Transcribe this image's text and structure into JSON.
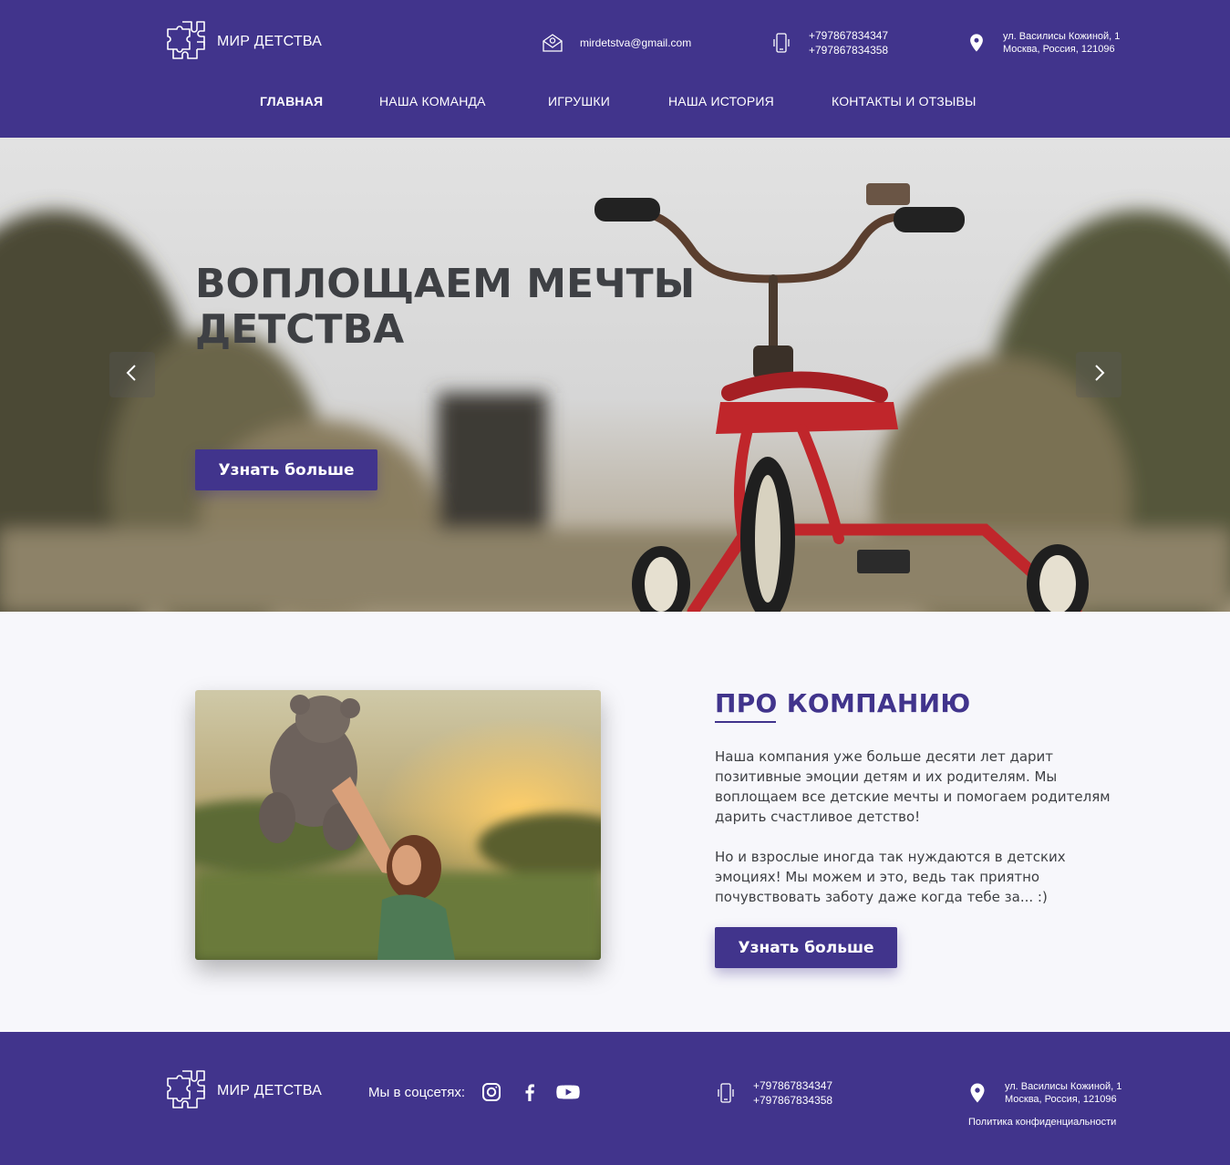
{
  "brand": {
    "name": "МИР ДЕТСТВА",
    "logo_icon": "puzzle-icon"
  },
  "header": {
    "email": {
      "icon": "email-icon",
      "value": "mirdetstva@gmail.com"
    },
    "phones": {
      "icon": "phone-icon",
      "line1": "+797867834347",
      "line2": "+797867834358"
    },
    "address": {
      "icon": "map-pin-icon",
      "line1": "ул. Василисы Кожиной, 1",
      "line2": "Москва, Россия, 121096"
    }
  },
  "nav": {
    "items": [
      {
        "label": "Главная",
        "active": true
      },
      {
        "label": "Наша команда",
        "active": false
      },
      {
        "label": "Игрушки",
        "active": false
      },
      {
        "label": "Наша история",
        "active": false
      },
      {
        "label": "Контакты и отзывы",
        "active": false
      }
    ]
  },
  "hero": {
    "title": "Воплощаем мечты детства",
    "button": "Узнать больше",
    "prev_icon": "chevron-left-icon",
    "next_icon": "chevron-right-icon"
  },
  "about": {
    "title": "Про компанию",
    "paragraph1": "Наша компания уже больше десяти лет дарит позитивные эмоции детям и их родителям. Мы воплощаем все детские мечты и помогаем родителям дарить счастливое детство!",
    "paragraph2": "Но и взрослые иногда так нуждаются в детских эмоциях! Мы можем и это, ведь так приятно почувствовать заботу даже когда тебе за... :)",
    "button": "Узнать больше"
  },
  "footer": {
    "social_label": "Мы в соцсетях:",
    "social_icons": [
      "instagram-icon",
      "facebook-icon",
      "youtube-icon"
    ],
    "phones": {
      "line1": "+797867834347",
      "line2": "+797867834358"
    },
    "address": {
      "line1": "ул. Василисы Кожиной, 1",
      "line2": "Москва, Россия, 121096"
    },
    "privacy": "Политика конфиденциальности"
  },
  "colors": {
    "primary": "#41348c",
    "heading_dark": "#3e4044",
    "section_bg": "#f7f7fb",
    "white": "#ffffff"
  }
}
